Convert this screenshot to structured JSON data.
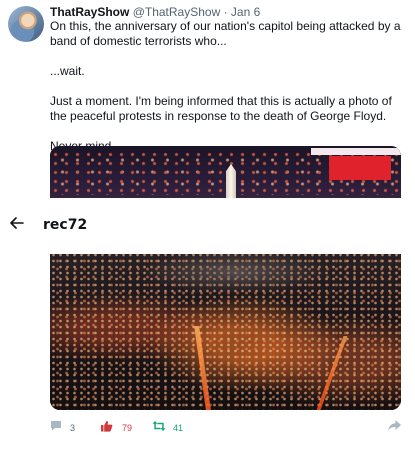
{
  "tweet": {
    "display_name": "ThatRayShow",
    "handle_date": "@ThatRayShow · Jan 6",
    "paragraphs": [
      "On this, the anniversary of our nation's capitol being attacked by a band of domestic terrorists who...",
      "...wait.",
      "Just a moment. I'm being informed that this is actually a photo of the peaceful protests in response to the death of George Floyd.",
      "Never mind."
    ]
  },
  "overlay": {
    "title": "rec72"
  },
  "actions": {
    "replies": "3",
    "likes": "79",
    "retweets": "41"
  },
  "colors": {
    "like": "#d0393e",
    "retweet": "#17a67a",
    "muted": "#536471"
  },
  "icons": [
    "avatar",
    "back-arrow-icon",
    "reply-icon",
    "like-icon",
    "retweet-icon",
    "share-icon"
  ]
}
